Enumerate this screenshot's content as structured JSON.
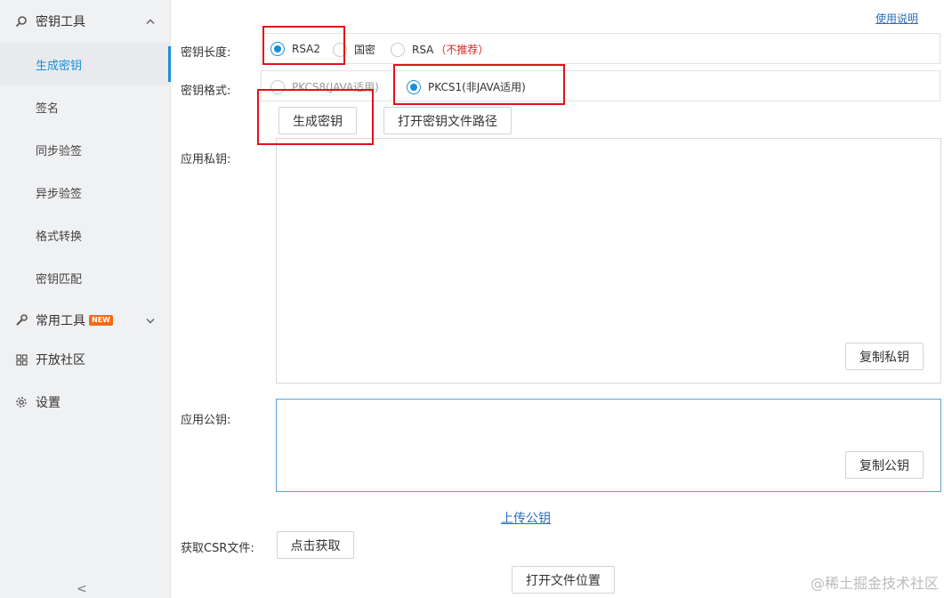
{
  "sidebar": {
    "group_keys": {
      "label": "密钥工具",
      "icon": "search-icon"
    },
    "items": [
      {
        "label": "生成密钥"
      },
      {
        "label": "签名"
      },
      {
        "label": "同步验签"
      },
      {
        "label": "异步验签"
      },
      {
        "label": "格式转换"
      },
      {
        "label": "密钥匹配"
      }
    ],
    "group_common": {
      "label": "常用工具",
      "badge": "NEW",
      "icon": "wrench-icon"
    },
    "group_community": {
      "label": "开放社区",
      "icon": "grid-icon"
    },
    "group_settings": {
      "label": "设置",
      "icon": "gear-icon"
    },
    "collapse": "<"
  },
  "main": {
    "help_link": "使用说明",
    "key_length": {
      "label": "密钥长度:",
      "options": [
        {
          "label": "RSA2",
          "selected": true
        },
        {
          "label": "国密",
          "selected": false
        },
        {
          "label": "RSA",
          "selected": false,
          "note": "（不推荐）"
        }
      ]
    },
    "key_format": {
      "label": "密钥格式:",
      "options": [
        {
          "label": "PKCS8(JAVA适用)",
          "selected": false
        },
        {
          "label": "PKCS1(非JAVA适用)",
          "selected": true
        }
      ]
    },
    "generate_button": "生成密钥",
    "open_path_button": "打开密钥文件路径",
    "private_key": {
      "label": "应用私钥:",
      "value": "",
      "copy_button": "复制私钥"
    },
    "public_key": {
      "label": "应用公钥:",
      "value": "",
      "copy_button": "复制公钥"
    },
    "upload_link": "上传公钥",
    "csr": {
      "label": "获取CSR文件:",
      "button": "点击获取"
    },
    "open_location_button": "打开文件位置"
  },
  "watermark": "@稀土掘金技术社区",
  "colors": {
    "accent": "#1a8fd6",
    "highlight": "#e0121a",
    "warning": "#e02020"
  }
}
